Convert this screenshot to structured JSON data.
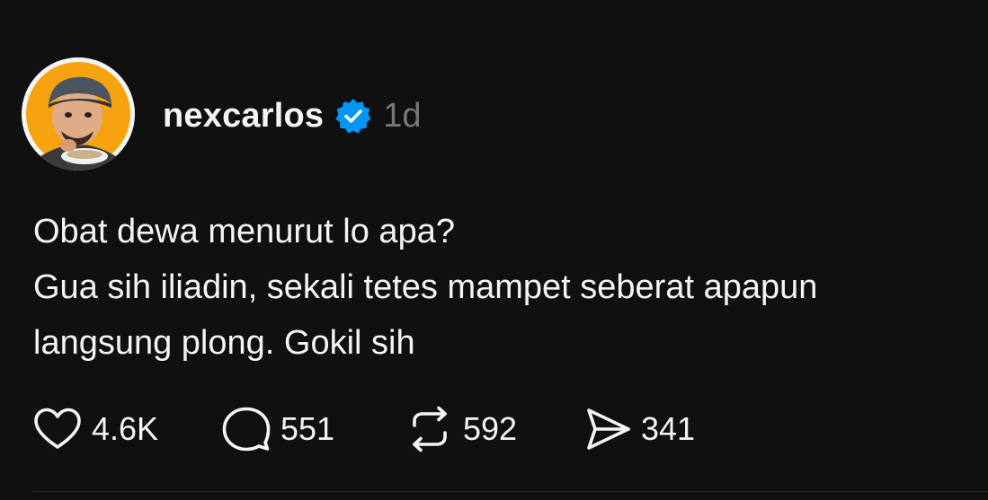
{
  "post": {
    "author": {
      "username": "nexcarlos",
      "verified": true,
      "avatar_icon": "avatar-photo",
      "avatar_bg": "#f7a20f"
    },
    "timestamp": "1d",
    "text_lines": [
      "Obat dewa menurut lo apa?",
      "Gua sih iliadin, sekali tetes mampet seberat apapun",
      "langsung plong. Gokil sih"
    ],
    "actions": {
      "like": {
        "icon": "heart-icon",
        "count": "4.6K"
      },
      "reply": {
        "icon": "speech-bubble-icon",
        "count": "551"
      },
      "repost": {
        "icon": "repost-icon",
        "count": "592"
      },
      "share": {
        "icon": "send-icon",
        "count": "341"
      }
    }
  },
  "colors": {
    "background": "#101010",
    "text": "#f3f5f7",
    "muted": "#777777",
    "verified": "#0095f6"
  }
}
